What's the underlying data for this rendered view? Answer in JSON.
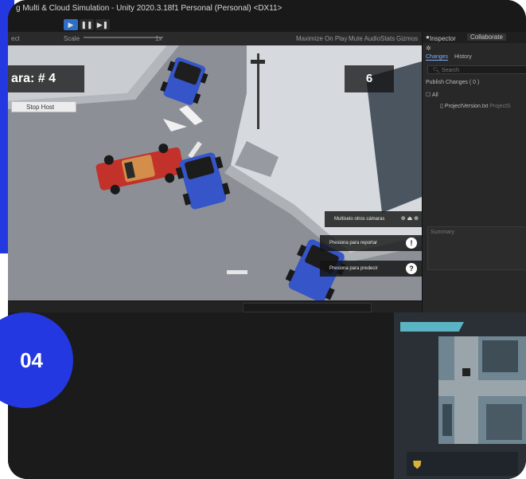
{
  "slide": {
    "number": "04"
  },
  "window": {
    "title": "g Multi & Cloud Simulation - Unity 2020.3.18f1 Personal (Personal) <DX11>"
  },
  "toolbar": {
    "play_icon": "play-icon",
    "pause_icon": "pause-icon",
    "step_icon": "step-icon"
  },
  "game_view": {
    "display_label": "ect",
    "scale_label": "Scale",
    "scale_value": "1x",
    "maximize_label": "Maximize On Play",
    "mute_label": "Mute Audio",
    "stats_label": "Stats",
    "gizmos_label": "Gizmos"
  },
  "hud": {
    "camera_label": "ara: # 4",
    "counter": "6",
    "stop_host_label": "Stop Host",
    "prompts": [
      {
        "label": "Multiselo otros cámaras",
        "key": "⊕ ⏏ ⊕"
      },
      {
        "label": "Presiona para reportar",
        "key": "!"
      },
      {
        "label": "Presiona para predecir",
        "key": "?"
      }
    ]
  },
  "inspector": {
    "tab_inspector": "Inspector",
    "tab_collaborate": "Collaborate",
    "subtab_changes": "Changes",
    "subtab_history": "History",
    "search_placeholder": "Search",
    "publish_label": "Publish Changes ( 0 )",
    "all_label": "All",
    "file_label": "ProjectVersion.txt",
    "file_path": "ProjectS",
    "summary_placeholder": "Summary"
  },
  "colors": {
    "accent": "#2338e0",
    "play_active": "#2e6ec7"
  }
}
